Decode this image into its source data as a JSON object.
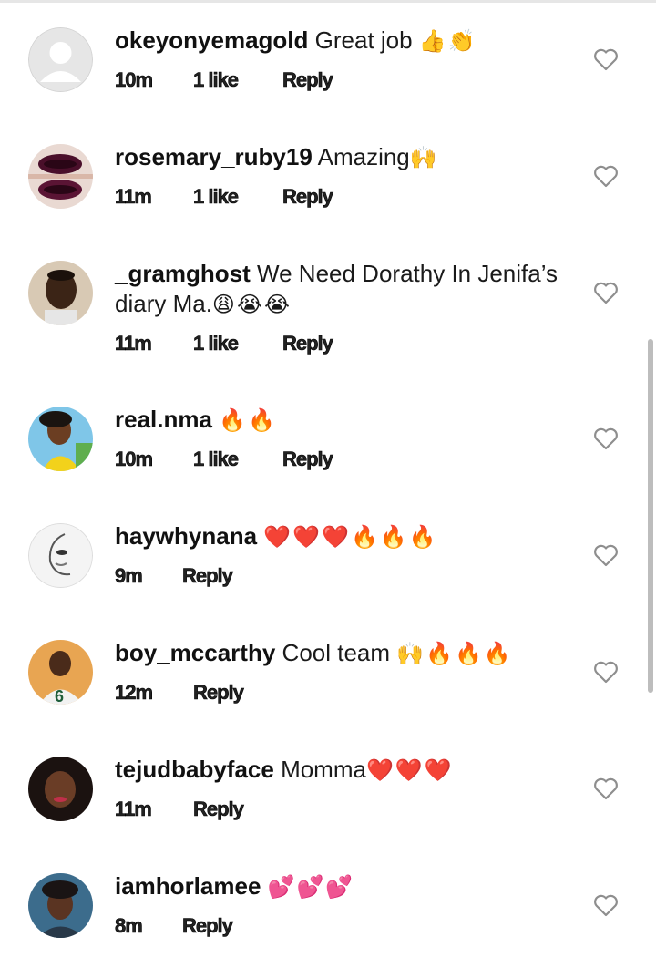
{
  "comments": [
    {
      "username": "okeyonyemagold",
      "text": "Great job",
      "emoji": "👍👏",
      "time": "10m",
      "likes": "1 like",
      "reply": "Reply"
    },
    {
      "username": "rosemary_ruby19",
      "text": "Amazing",
      "emoji": "🙌",
      "time": "11m",
      "likes": "1 like",
      "reply": "Reply"
    },
    {
      "username": "_gramghost",
      "text": "We Need Dorathy In Jenifa’s diary Ma.",
      "emoji": "😩😭😭",
      "time": "11m",
      "likes": "1 like",
      "reply": "Reply"
    },
    {
      "username": "real.nma",
      "text": "",
      "emoji": "🔥🔥",
      "time": "10m",
      "likes": "1 like",
      "reply": "Reply"
    },
    {
      "username": "haywhynana",
      "text": "",
      "emoji": "❤️❤️❤️🔥🔥🔥",
      "time": "9m",
      "likes": "",
      "reply": "Reply"
    },
    {
      "username": "boy_mccarthy",
      "text": "Cool team",
      "emoji": "🙌🔥🔥🔥",
      "time": "12m",
      "likes": "",
      "reply": "Reply"
    },
    {
      "username": "tejudbabyface",
      "text": "Momma",
      "emoji": "❤️❤️❤️",
      "time": "11m",
      "likes": "",
      "reply": "Reply"
    },
    {
      "username": "iamhorlamee",
      "text": "",
      "emoji": "💕💕💕",
      "time": "8m",
      "likes": "",
      "reply": "Reply"
    }
  ],
  "icons": {
    "like": "heart-outline-icon",
    "avatar_default": "default-avatar-icon"
  },
  "colors": {
    "heart_stroke": "#8e8e8e",
    "emoji_red": "#e0245e",
    "fire": "#f5a623"
  }
}
